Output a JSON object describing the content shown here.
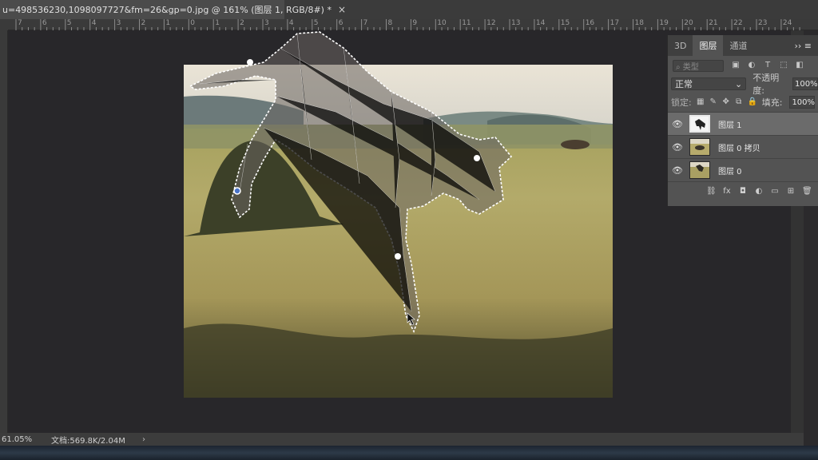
{
  "tab": {
    "title": "u=498536230,1098097727&fm=26&gp=0.jpg @ 161% (图层 1, RGB/8#) *",
    "close": "×"
  },
  "ruler": {
    "labels": [
      "7",
      "6",
      "5",
      "4",
      "3",
      "2",
      "1",
      "0",
      "1",
      "2",
      "3",
      "4",
      "5",
      "6",
      "7",
      "8",
      "9",
      "10",
      "11",
      "12",
      "13",
      "14",
      "15",
      "16",
      "17",
      "18",
      "19",
      "20",
      "21",
      "22",
      "23",
      "24"
    ]
  },
  "status": {
    "zoom": "61.05%",
    "doc": "文档:569.8K/2.04M",
    "arrow": "›"
  },
  "panel": {
    "tabs": [
      "3D",
      "图层",
      "通道"
    ],
    "menu": "››  ≡",
    "filter_placeholder": "⌕ 类型",
    "filter_icons": [
      "▣",
      "◐",
      "T",
      "⬚",
      "◧"
    ],
    "blend_mode": "正常",
    "blend_arrow": "⌄",
    "opacity_label": "不透明度:",
    "opacity_value": "100%",
    "lock_label": "锁定:",
    "lock_icons": [
      "▦",
      "✎",
      "✥",
      "⧉",
      "🔒"
    ],
    "fill_label": "填充:",
    "fill_value": "100%",
    "layers": [
      {
        "name": "图层 1",
        "selected": true
      },
      {
        "name": "图层 0 拷贝",
        "selected": false
      },
      {
        "name": "图层 0",
        "selected": false
      }
    ],
    "eye": "👁",
    "footer_icons": [
      "⛓",
      "fx",
      "◘",
      "◐",
      "▭",
      "⊞",
      "🗑"
    ]
  },
  "colors": {
    "accent": "#2b2a2c",
    "panel": "#535353",
    "selection": "#ffffff"
  }
}
